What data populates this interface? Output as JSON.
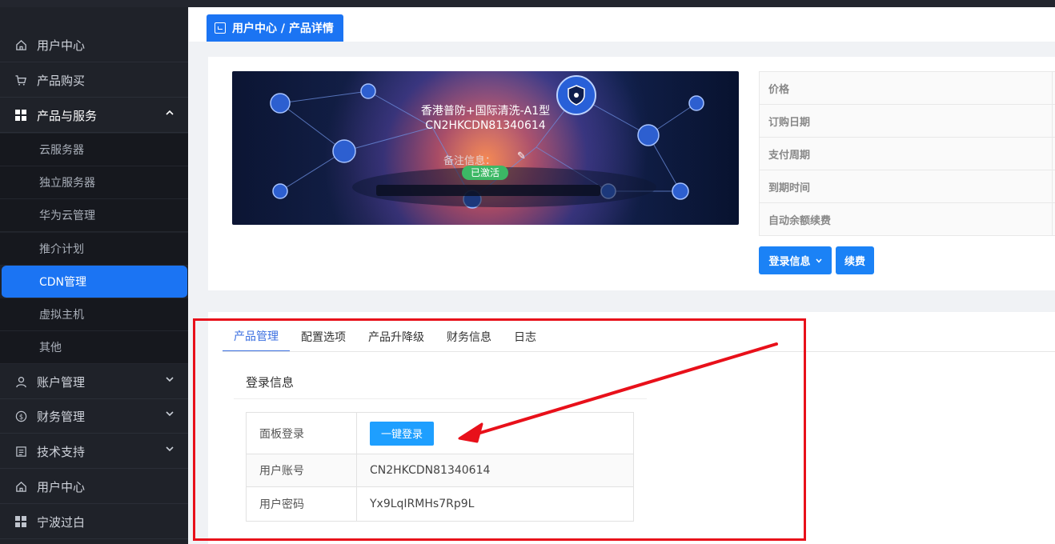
{
  "colors": {
    "accent": "#1b74f3",
    "active_tab": "#3b6fe0",
    "badge": "#3cb865",
    "annotation": "#e8101a",
    "sidebar_bg": "#1f2229"
  },
  "sidebar": {
    "items": [
      {
        "label": "用户中心",
        "icon": "home-icon"
      },
      {
        "label": "产品购买",
        "icon": "cart-icon"
      },
      {
        "label": "产品与服务",
        "icon": "grid-icon",
        "expanded": true
      },
      {
        "label": "账户管理",
        "icon": "user-icon"
      },
      {
        "label": "财务管理",
        "icon": "dollar-icon"
      },
      {
        "label": "技术支持",
        "icon": "document-icon"
      },
      {
        "label": "用户中心",
        "icon": "home-icon"
      },
      {
        "label": "宁波过白",
        "icon": "grid-icon"
      }
    ],
    "subitems": [
      "云服务器",
      "独立服务器",
      "华为云管理",
      "推介计划",
      "CDN管理",
      "虚拟主机",
      "其他"
    ],
    "active_subitem": "CDN管理"
  },
  "breadcrumb": {
    "text": "用户中心 / 产品详情"
  },
  "product": {
    "name": "香港普防+国际清洗-A1型",
    "id": "CN2HKCDN81340614",
    "note_label": "备注信息：",
    "status": "已激活",
    "info_labels": [
      "价格",
      "订购日期",
      "支付周期",
      "到期时间",
      "自动余额续费"
    ],
    "login_info_button": "登录信息",
    "renew_button": "续费"
  },
  "tabs": [
    "产品管理",
    "配置选项",
    "产品升降级",
    "财务信息",
    "日志"
  ],
  "active_tab": "产品管理",
  "login_section": {
    "title": "登录信息",
    "rows": [
      {
        "key": "面板登录",
        "button": "一键登录"
      },
      {
        "key": "用户账号",
        "value": "CN2HKCDN81340614"
      },
      {
        "key": "用户密码",
        "value": "Yx9LqIRMHs7Rp9L"
      }
    ]
  }
}
